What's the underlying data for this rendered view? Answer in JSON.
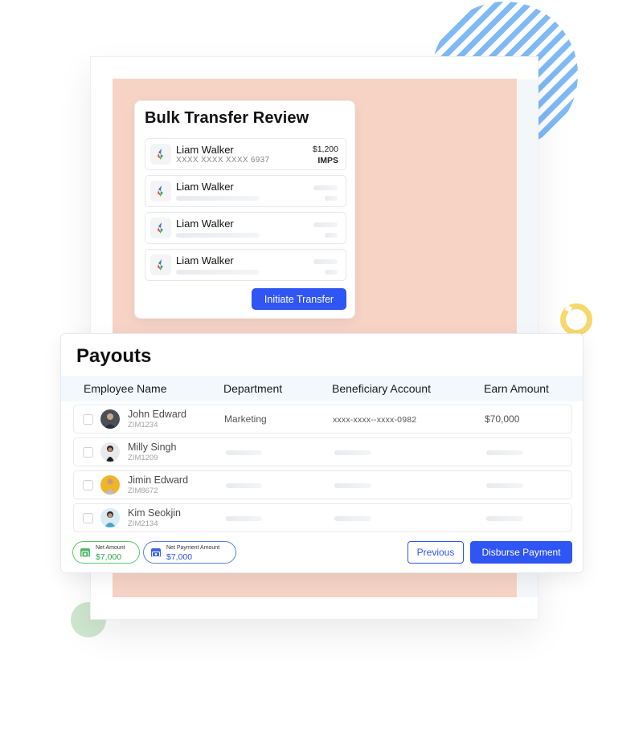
{
  "bulk_transfer": {
    "title": "Bulk Transfer Review",
    "rows": [
      {
        "name": "Liam Walker",
        "account": "XXXX XXXX XXXX 6937",
        "amount": "$1,200",
        "mode": "IMPS"
      },
      {
        "name": "Liam Walker"
      },
      {
        "name": "Liam Walker"
      },
      {
        "name": "Liam Walker"
      }
    ],
    "initiate_label": "Initiate Transfer"
  },
  "payouts": {
    "title": "Payouts",
    "columns": [
      "Employee Name",
      "Department",
      "Beneficiary Account",
      "Earn Amount"
    ],
    "rows": [
      {
        "name": "John Edward",
        "id": "ZIM1234",
        "department": "Marketing",
        "account": "xxxx-xxxx--xxxx-0982",
        "amount": "$70,000"
      },
      {
        "name": "Milly Singh",
        "id": "ZIM1209"
      },
      {
        "name": "Jimin Edward",
        "id": "ZIM8672"
      },
      {
        "name": "Kim Seokjin",
        "id": "ZIM2134"
      }
    ],
    "summary": [
      {
        "label": "Net Amount",
        "value": "$7,000",
        "color": "#2fa84f",
        "icon": "cash-icon"
      },
      {
        "label": "Net Payment Amount",
        "value": "$7,000",
        "color": "#2f55f4",
        "icon": "money-icon"
      }
    ],
    "previous_label": "Previous",
    "disburse_label": "Disburse Payment"
  },
  "colors": {
    "accent": "#2f55f4",
    "background_panel": "#f7d3c6",
    "stripe": "#7fbaf5",
    "ring": "#f6d86b",
    "green_dot": "#cfe6cf"
  }
}
